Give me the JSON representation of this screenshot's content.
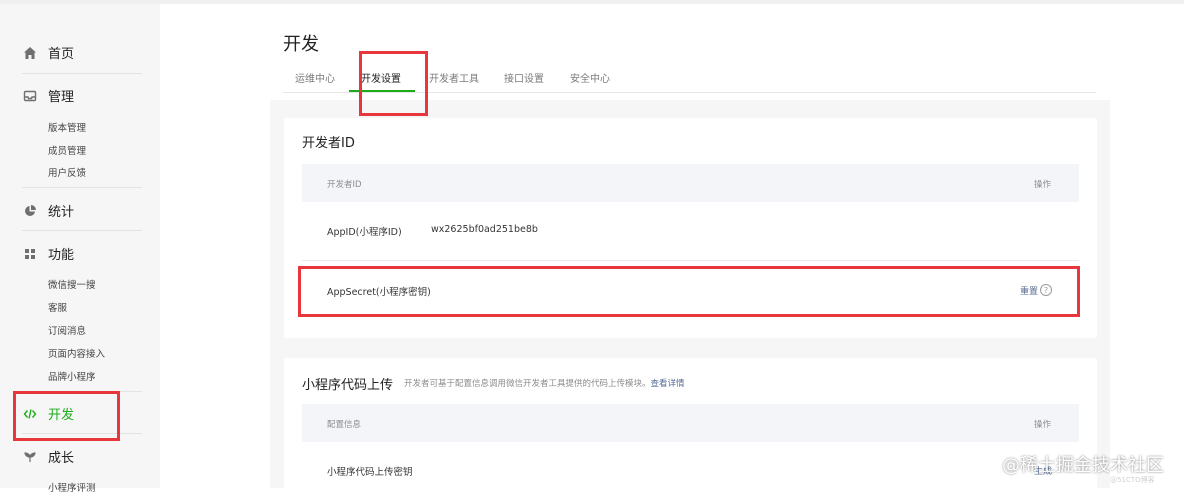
{
  "sidebar": {
    "items": [
      {
        "label": "首页",
        "icon": "home-icon"
      },
      {
        "label": "管理",
        "icon": "inbox-icon",
        "sub": [
          "版本管理",
          "成员管理",
          "用户反馈"
        ]
      },
      {
        "label": "统计",
        "icon": "pie-chart-icon"
      },
      {
        "label": "功能",
        "icon": "grid-icon",
        "sub": [
          "微信搜一搜",
          "客服",
          "订阅消息",
          "页面内容接入",
          "品牌小程序"
        ]
      },
      {
        "label": "开发",
        "icon": "code-icon",
        "active": true
      },
      {
        "label": "成长",
        "icon": "sprout-icon",
        "sub": [
          "小程序评测"
        ]
      }
    ]
  },
  "page": {
    "title": "开发"
  },
  "tabs": [
    {
      "label": "运维中心"
    },
    {
      "label": "开发设置",
      "active": true
    },
    {
      "label": "开发者工具"
    },
    {
      "label": "接口设置"
    },
    {
      "label": "安全中心"
    }
  ],
  "dev_id_card": {
    "title": "开发者ID",
    "col_name": "开发者ID",
    "col_op": "操作",
    "rows": [
      {
        "name": "AppID(小程序ID)",
        "value": "wx2625bf0ad251be8b",
        "op": ""
      },
      {
        "name": "AppSecret(小程序密钥)",
        "value": "",
        "op": "重置"
      }
    ]
  },
  "upload_card": {
    "title": "小程序代码上传",
    "desc": "开发者可基于配置信息调用微信开发者工具提供的代码上传模块。",
    "desc_link": "查看详情",
    "col_name": "配置信息",
    "col_op": "操作",
    "rows": [
      {
        "name": "小程序代码上传密钥",
        "op": "生成"
      }
    ]
  },
  "watermark": {
    "main": "@稀土掘金技术社区",
    "sub": "@51CTO博客"
  },
  "colors": {
    "accent": "#1aad19",
    "highlight": "#e8373c",
    "link": "#576b95"
  }
}
